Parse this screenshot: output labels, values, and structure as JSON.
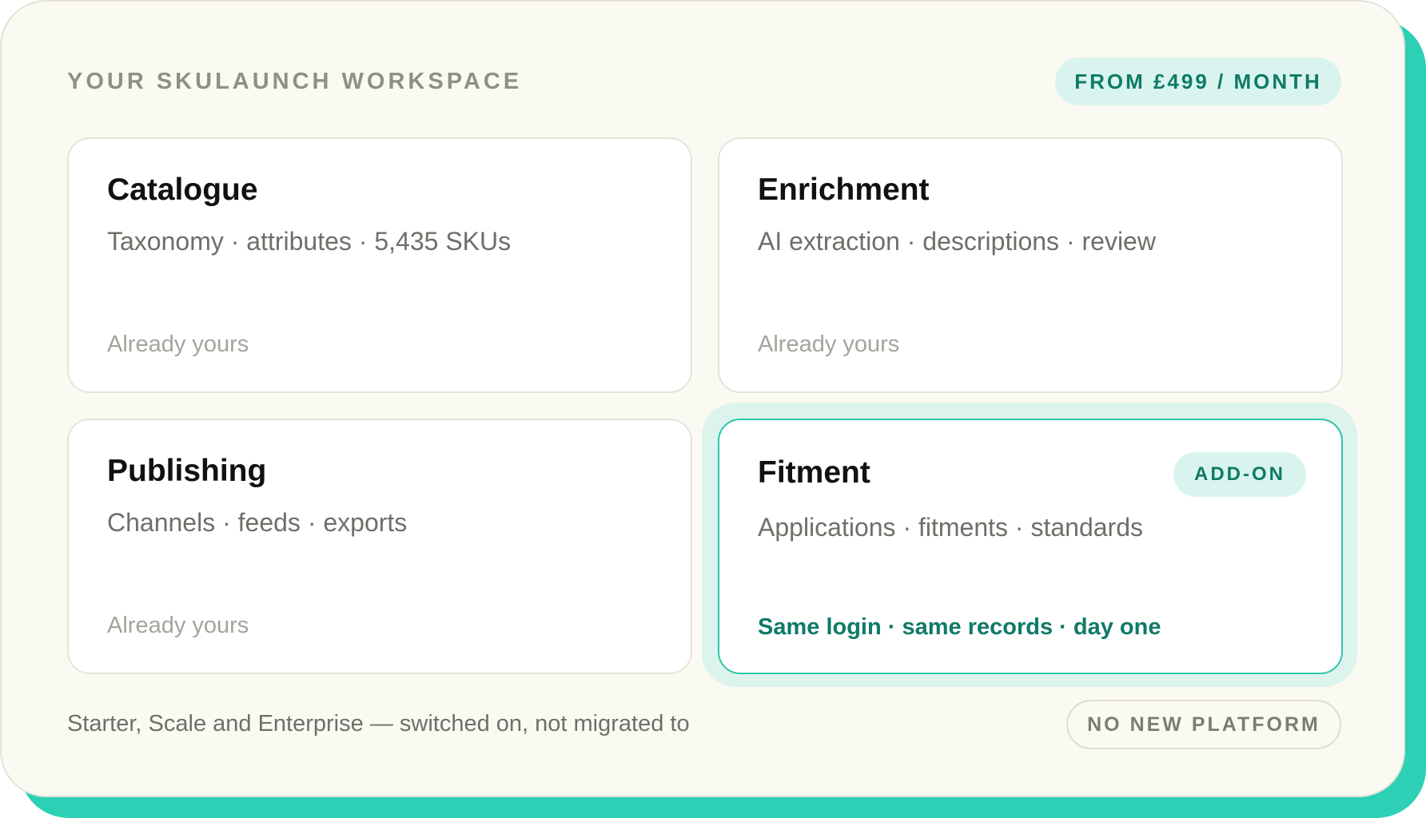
{
  "header": {
    "title": "YOUR SKULAUNCH WORKSPACE",
    "price_badge": "FROM £499 / MONTH"
  },
  "modules": [
    {
      "title": "Catalogue",
      "subtitle": "Taxonomy · attributes · 5,435 SKUs",
      "status": "Already yours"
    },
    {
      "title": "Enrichment",
      "subtitle": "AI extraction · descriptions · review",
      "status": "Already yours"
    },
    {
      "title": "Publishing",
      "subtitle": "Channels · feeds · exports",
      "status": "Already yours"
    },
    {
      "title": "Fitment",
      "badge": "ADD-ON",
      "subtitle": "Applications · fitments · standards",
      "status": "Same login · same records · day one"
    }
  ],
  "footer": {
    "text": "Starter, Scale and Enterprise — switched on, not migrated to",
    "pill": "NO NEW PLATFORM"
  },
  "colors": {
    "accent": "#2dd0b4",
    "accent_dark": "#0f7a66",
    "accent_light": "#d9f4ee",
    "panel_bg": "#fbfaf2"
  }
}
